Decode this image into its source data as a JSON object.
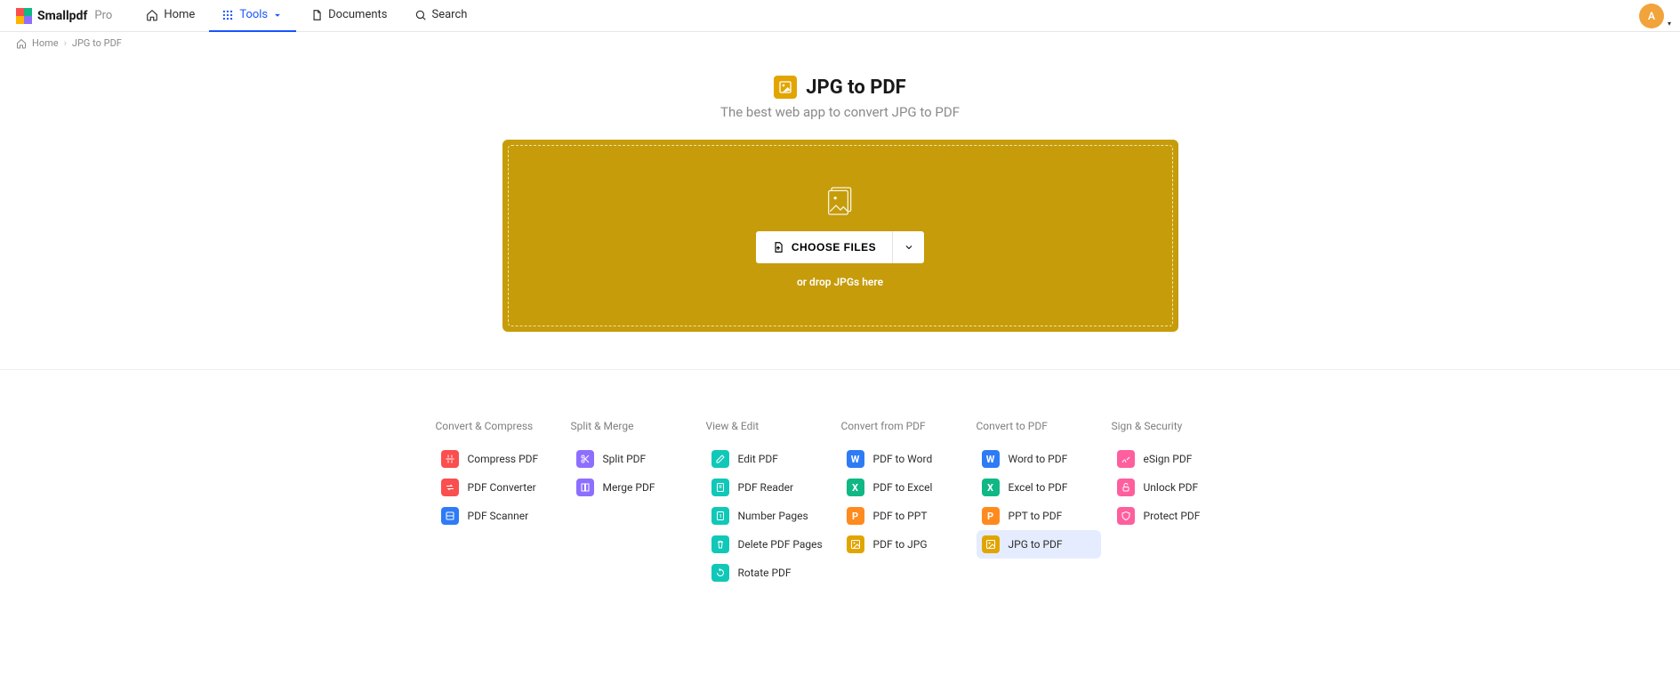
{
  "brand": {
    "name": "Smallpdf",
    "tier": "Pro"
  },
  "nav": {
    "home": "Home",
    "tools": "Tools",
    "documents": "Documents",
    "search": "Search"
  },
  "avatar": {
    "initial": "A"
  },
  "breadcrumb": {
    "home": "Home",
    "current": "JPG to PDF"
  },
  "hero": {
    "title": "JPG to PDF",
    "subtitle": "The best web app to convert JPG to PDF"
  },
  "dropzone": {
    "button": "CHOOSE FILES",
    "hint": "or drop JPGs here"
  },
  "columns": [
    {
      "title": "Convert & Compress",
      "tools": [
        {
          "label": "Compress PDF",
          "color": "c-red",
          "icon": "compress"
        },
        {
          "label": "PDF Converter",
          "color": "c-red",
          "icon": "convert"
        },
        {
          "label": "PDF Scanner",
          "color": "c-blue",
          "icon": "scan"
        }
      ]
    },
    {
      "title": "Split & Merge",
      "tools": [
        {
          "label": "Split PDF",
          "color": "c-purple",
          "icon": "split"
        },
        {
          "label": "Merge PDF",
          "color": "c-purple",
          "icon": "merge"
        }
      ]
    },
    {
      "title": "View & Edit",
      "tools": [
        {
          "label": "Edit PDF",
          "color": "c-teal",
          "icon": "edit"
        },
        {
          "label": "PDF Reader",
          "color": "c-teal",
          "icon": "reader"
        },
        {
          "label": "Number Pages",
          "color": "c-teal",
          "icon": "number"
        },
        {
          "label": "Delete PDF Pages",
          "color": "c-teal",
          "icon": "delete"
        },
        {
          "label": "Rotate PDF",
          "color": "c-teal",
          "icon": "rotate"
        }
      ]
    },
    {
      "title": "Convert from PDF",
      "tools": [
        {
          "label": "PDF to Word",
          "color": "c-blue",
          "icon": "W"
        },
        {
          "label": "PDF to Excel",
          "color": "c-green",
          "icon": "X"
        },
        {
          "label": "PDF to PPT",
          "color": "c-orange",
          "icon": "P"
        },
        {
          "label": "PDF to JPG",
          "color": "c-yellow",
          "icon": "img"
        }
      ]
    },
    {
      "title": "Convert to PDF",
      "tools": [
        {
          "label": "Word to PDF",
          "color": "c-blue",
          "icon": "W"
        },
        {
          "label": "Excel to PDF",
          "color": "c-green",
          "icon": "X"
        },
        {
          "label": "PPT to PDF",
          "color": "c-orange",
          "icon": "P"
        },
        {
          "label": "JPG to PDF",
          "color": "c-yellow",
          "icon": "img",
          "active": true
        }
      ]
    },
    {
      "title": "Sign & Security",
      "tools": [
        {
          "label": "eSign PDF",
          "color": "c-pink",
          "icon": "sign"
        },
        {
          "label": "Unlock PDF",
          "color": "c-pink",
          "icon": "unlock"
        },
        {
          "label": "Protect PDF",
          "color": "c-pink",
          "icon": "protect"
        }
      ]
    }
  ]
}
